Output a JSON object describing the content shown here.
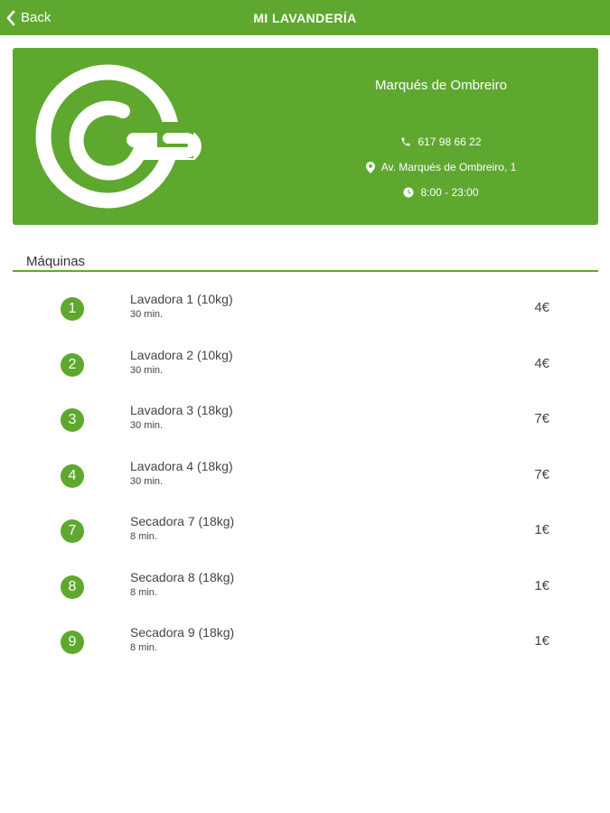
{
  "nav": {
    "back_label": "Back",
    "title": "MI LAVANDERÍA"
  },
  "shop": {
    "name": "Marqués de Ombreiro",
    "phone": "617 98 66 22",
    "address": "Av. Marqués de Ombreiro, 1",
    "hours": "8:00 - 23:00"
  },
  "section": {
    "title": "Máquinas"
  },
  "machines": [
    {
      "number": "1",
      "name": "Lavadora 1 (10kg)",
      "time": "30 min.",
      "price": "4€"
    },
    {
      "number": "2",
      "name": "Lavadora 2 (10kg)",
      "time": "30 min.",
      "price": "4€"
    },
    {
      "number": "3",
      "name": "Lavadora 3 (18kg)",
      "time": "30 min.",
      "price": "7€"
    },
    {
      "number": "4",
      "name": "Lavadora 4 (18kg)",
      "time": "30 min.",
      "price": "7€"
    },
    {
      "number": "7",
      "name": "Secadora 7 (18kg)",
      "time": "8 min.",
      "price": "1€"
    },
    {
      "number": "8",
      "name": "Secadora 8 (18kg)",
      "time": "8 min.",
      "price": "1€"
    },
    {
      "number": "9",
      "name": "Secadora 9 (18kg)",
      "time": "8 min.",
      "price": "1€"
    }
  ],
  "colors": {
    "accent": "#5ea82f",
    "text": "#444444",
    "background": "#ffffff"
  },
  "icons": [
    "chevron-left-icon",
    "brand-logo",
    "phone-icon",
    "map-pin-icon",
    "clock-icon"
  ]
}
